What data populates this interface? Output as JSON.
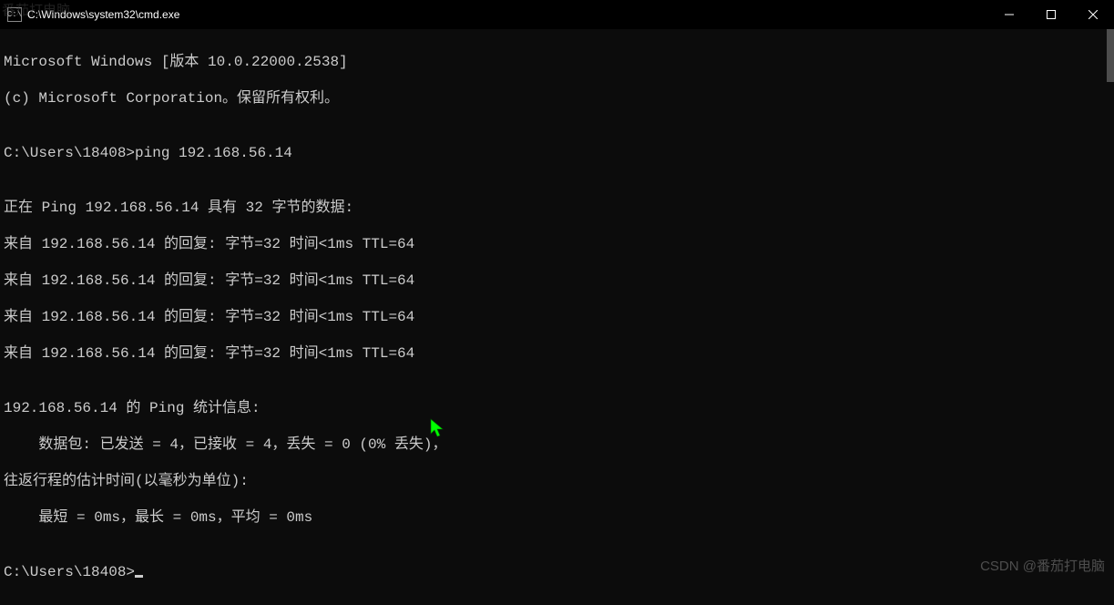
{
  "ghost_text": "番茄打电脑",
  "titlebar": {
    "title": "C:\\Windows\\system32\\cmd.exe"
  },
  "terminal": {
    "line1": "Microsoft Windows [版本 10.0.22000.2538]",
    "line2": "(c) Microsoft Corporation。保留所有权利。",
    "blank1": "",
    "prompt1": "C:\\Users\\18408>ping 192.168.56.14",
    "blank2": "",
    "pinging": "正在 Ping 192.168.56.14 具有 32 字节的数据:",
    "reply1": "来自 192.168.56.14 的回复: 字节=32 时间<1ms TTL=64",
    "reply2": "来自 192.168.56.14 的回复: 字节=32 时间<1ms TTL=64",
    "reply3": "来自 192.168.56.14 的回复: 字节=32 时间<1ms TTL=64",
    "reply4": "来自 192.168.56.14 的回复: 字节=32 时间<1ms TTL=64",
    "blank3": "",
    "stats_header": "192.168.56.14 的 Ping 统计信息:",
    "stats_packets": "    数据包: 已发送 = 4，已接收 = 4，丢失 = 0 (0% 丢失)，",
    "stats_rtt_header": "往返行程的估计时间(以毫秒为单位):",
    "stats_rtt": "    最短 = 0ms，最长 = 0ms，平均 = 0ms",
    "blank4": "",
    "prompt2": "C:\\Users\\18408>"
  },
  "watermark": "CSDN @番茄打电脑"
}
